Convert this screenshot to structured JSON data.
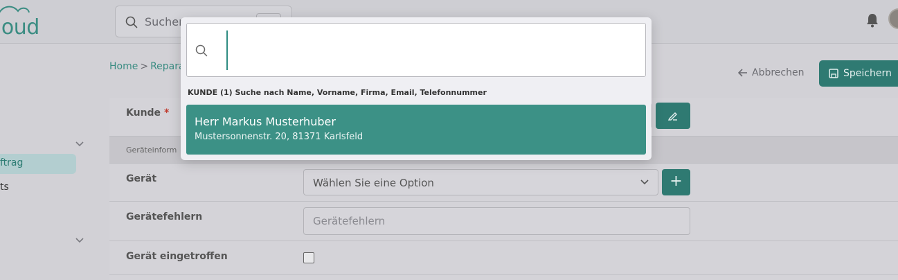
{
  "header": {
    "logo_text": "loud",
    "search_placeholder": "Suchen"
  },
  "sidebar": {
    "active_item_label": "ftrag",
    "item_label_2": "ts"
  },
  "breadcrumb": {
    "home": "Home",
    "separator": ">",
    "current": "Reparat"
  },
  "actions": {
    "cancel_label": "Abbrechen",
    "save_label": "Speichern"
  },
  "form": {
    "customer_label": "Kunde",
    "required_marker": "*",
    "section_title": "Geräteinform",
    "device_label": "Gerät",
    "device_select_value": "Wählen Sie eine Option",
    "device_errors_label": "Gerätefehlern",
    "device_errors_placeholder": "Gerätefehlern",
    "device_arrived_label": "Gerät eingetroffen",
    "device_arrived_checked": false,
    "add_device_label": "+"
  },
  "search_modal": {
    "query": "",
    "result_caption": "KUNDE (1) Suche nach Name, Vorname, Firma, Email, Telefonnummer",
    "results": [
      {
        "name": "Herr Markus Musterhuber",
        "address": "Mustersonnenstr. 20, 81371 Karlsfeld"
      }
    ]
  },
  "colors": {
    "accent": "#3c9186",
    "accent_dark": "#2f7a72",
    "required": "#c0392b"
  }
}
